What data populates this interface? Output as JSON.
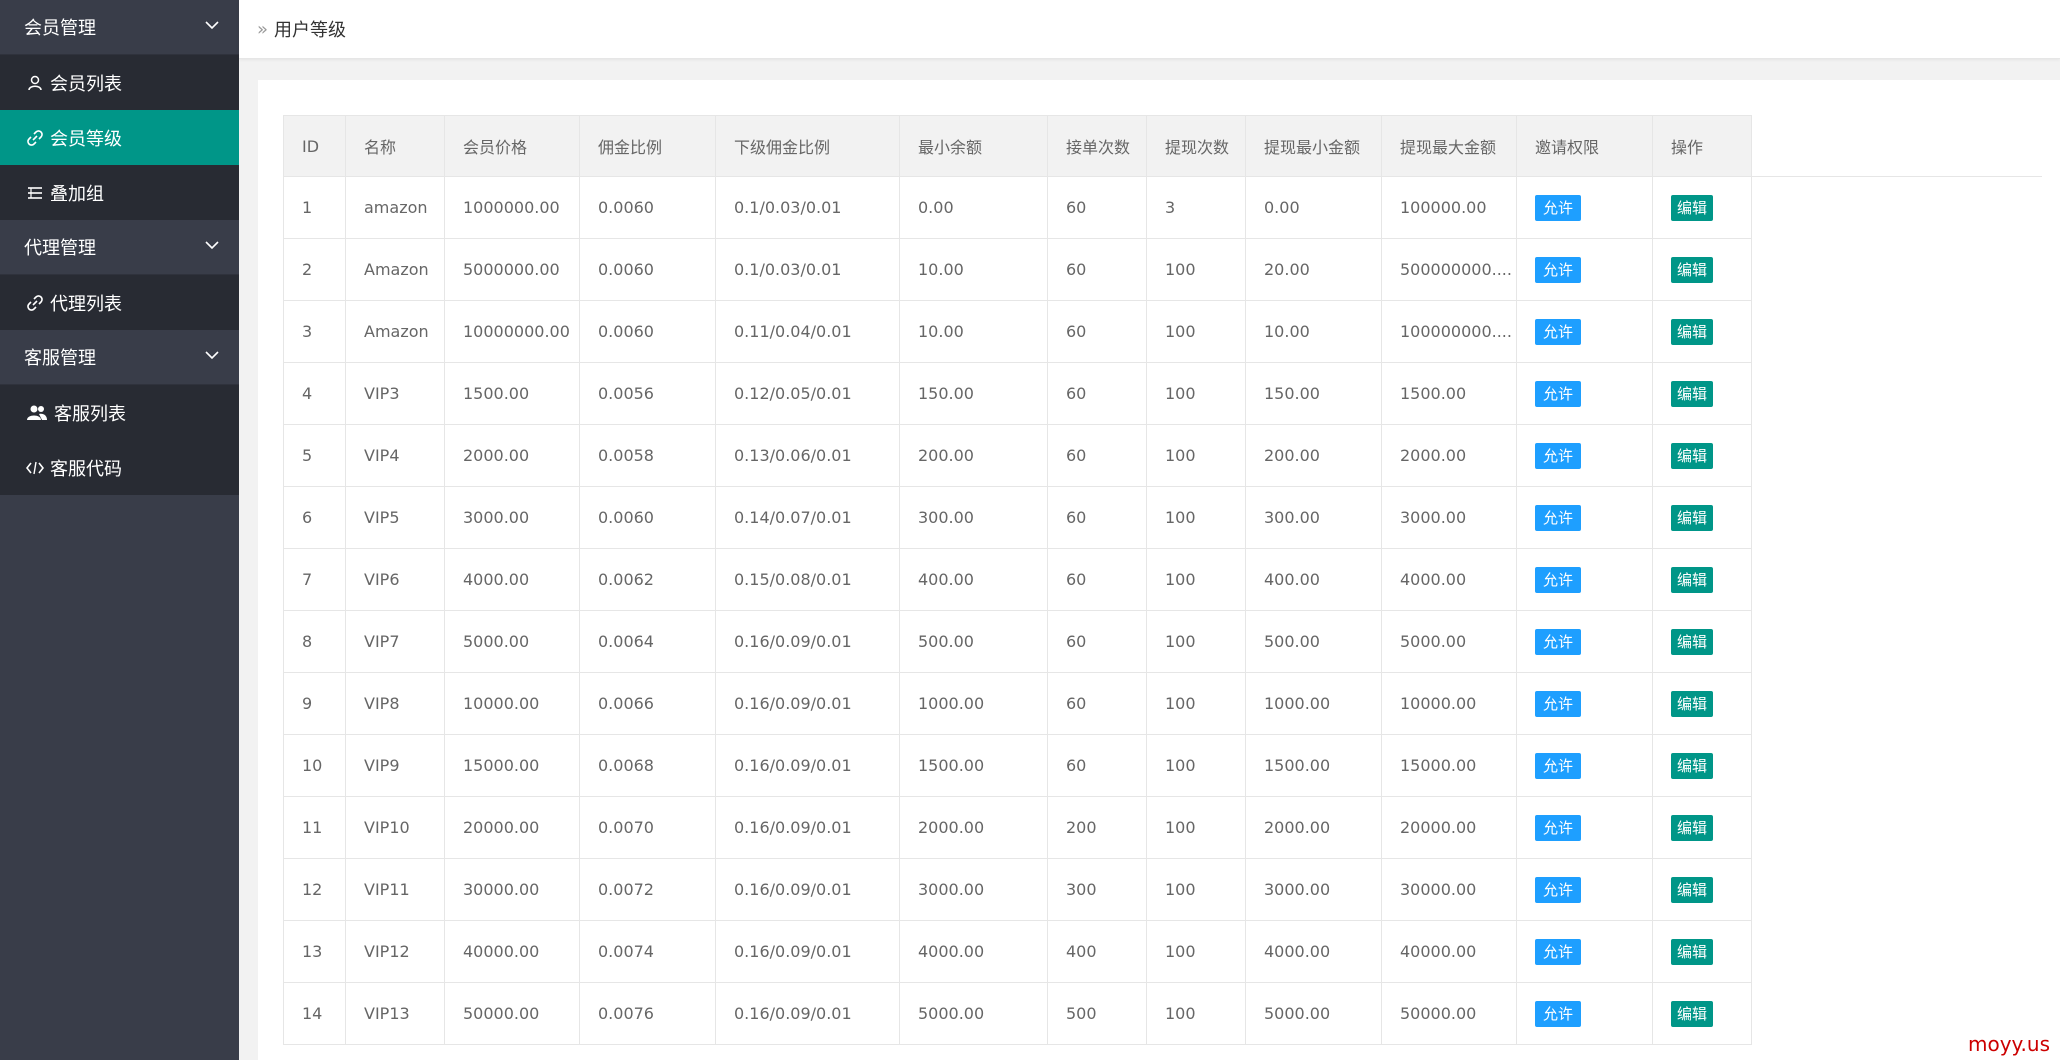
{
  "sidebar": {
    "groups": [
      {
        "label": "会员管理",
        "items": [
          {
            "label": "会员列表",
            "icon": "user-icon",
            "active": false
          },
          {
            "label": "会员等级",
            "icon": "link-icon",
            "active": true
          },
          {
            "label": "叠加组",
            "icon": "list-icon",
            "active": false
          }
        ]
      },
      {
        "label": "代理管理",
        "items": [
          {
            "label": "代理列表",
            "icon": "link-icon",
            "active": false
          }
        ]
      },
      {
        "label": "客服管理",
        "items": [
          {
            "label": "客服列表",
            "icon": "users-icon",
            "active": false
          },
          {
            "label": "客服代码",
            "icon": "code-icon",
            "active": false
          }
        ]
      }
    ]
  },
  "header": {
    "breadcrumb_sep": "»",
    "title": "用户等级"
  },
  "table": {
    "columns": [
      "ID",
      "名称",
      "会员价格",
      "佣金比例",
      "下级佣金比例",
      "最小余额",
      "接单次数",
      "提现次数",
      "提现最小金额",
      "提现最大金额",
      "邀请权限",
      "操作"
    ],
    "rows": [
      {
        "id": "1",
        "name": "amazon",
        "price": "1000000.00",
        "rate": "0.0060",
        "sub_rate": "0.1/0.03/0.01",
        "min_balance": "0.00",
        "orders": "60",
        "withdraws": "3",
        "wd_min": "0.00",
        "wd_max": "100000.00",
        "invite": "允许",
        "action": "编辑"
      },
      {
        "id": "2",
        "name": "Amazon",
        "price": "5000000.00",
        "rate": "0.0060",
        "sub_rate": "0.1/0.03/0.01",
        "min_balance": "10.00",
        "orders": "60",
        "withdraws": "100",
        "wd_min": "20.00",
        "wd_max": "500000000....",
        "invite": "允许",
        "action": "编辑"
      },
      {
        "id": "3",
        "name": "Amazon",
        "price": "10000000.00",
        "rate": "0.0060",
        "sub_rate": "0.11/0.04/0.01",
        "min_balance": "10.00",
        "orders": "60",
        "withdraws": "100",
        "wd_min": "10.00",
        "wd_max": "100000000....",
        "invite": "允许",
        "action": "编辑"
      },
      {
        "id": "4",
        "name": "VIP3",
        "price": "1500.00",
        "rate": "0.0056",
        "sub_rate": "0.12/0.05/0.01",
        "min_balance": "150.00",
        "orders": "60",
        "withdraws": "100",
        "wd_min": "150.00",
        "wd_max": "1500.00",
        "invite": "允许",
        "action": "编辑"
      },
      {
        "id": "5",
        "name": "VIP4",
        "price": "2000.00",
        "rate": "0.0058",
        "sub_rate": "0.13/0.06/0.01",
        "min_balance": "200.00",
        "orders": "60",
        "withdraws": "100",
        "wd_min": "200.00",
        "wd_max": "2000.00",
        "invite": "允许",
        "action": "编辑"
      },
      {
        "id": "6",
        "name": "VIP5",
        "price": "3000.00",
        "rate": "0.0060",
        "sub_rate": "0.14/0.07/0.01",
        "min_balance": "300.00",
        "orders": "60",
        "withdraws": "100",
        "wd_min": "300.00",
        "wd_max": "3000.00",
        "invite": "允许",
        "action": "编辑"
      },
      {
        "id": "7",
        "name": "VIP6",
        "price": "4000.00",
        "rate": "0.0062",
        "sub_rate": "0.15/0.08/0.01",
        "min_balance": "400.00",
        "orders": "60",
        "withdraws": "100",
        "wd_min": "400.00",
        "wd_max": "4000.00",
        "invite": "允许",
        "action": "编辑"
      },
      {
        "id": "8",
        "name": "VIP7",
        "price": "5000.00",
        "rate": "0.0064",
        "sub_rate": "0.16/0.09/0.01",
        "min_balance": "500.00",
        "orders": "60",
        "withdraws": "100",
        "wd_min": "500.00",
        "wd_max": "5000.00",
        "invite": "允许",
        "action": "编辑"
      },
      {
        "id": "9",
        "name": "VIP8",
        "price": "10000.00",
        "rate": "0.0066",
        "sub_rate": "0.16/0.09/0.01",
        "min_balance": "1000.00",
        "orders": "60",
        "withdraws": "100",
        "wd_min": "1000.00",
        "wd_max": "10000.00",
        "invite": "允许",
        "action": "编辑"
      },
      {
        "id": "10",
        "name": "VIP9",
        "price": "15000.00",
        "rate": "0.0068",
        "sub_rate": "0.16/0.09/0.01",
        "min_balance": "1500.00",
        "orders": "60",
        "withdraws": "100",
        "wd_min": "1500.00",
        "wd_max": "15000.00",
        "invite": "允许",
        "action": "编辑"
      },
      {
        "id": "11",
        "name": "VIP10",
        "price": "20000.00",
        "rate": "0.0070",
        "sub_rate": "0.16/0.09/0.01",
        "min_balance": "2000.00",
        "orders": "200",
        "withdraws": "100",
        "wd_min": "2000.00",
        "wd_max": "20000.00",
        "invite": "允许",
        "action": "编辑"
      },
      {
        "id": "12",
        "name": "VIP11",
        "price": "30000.00",
        "rate": "0.0072",
        "sub_rate": "0.16/0.09/0.01",
        "min_balance": "3000.00",
        "orders": "300",
        "withdraws": "100",
        "wd_min": "3000.00",
        "wd_max": "30000.00",
        "invite": "允许",
        "action": "编辑"
      },
      {
        "id": "13",
        "name": "VIP12",
        "price": "40000.00",
        "rate": "0.0074",
        "sub_rate": "0.16/0.09/0.01",
        "min_balance": "4000.00",
        "orders": "400",
        "withdraws": "100",
        "wd_min": "4000.00",
        "wd_max": "40000.00",
        "invite": "允许",
        "action": "编辑"
      },
      {
        "id": "14",
        "name": "VIP13",
        "price": "50000.00",
        "rate": "0.0076",
        "sub_rate": "0.16/0.09/0.01",
        "min_balance": "5000.00",
        "orders": "500",
        "withdraws": "100",
        "wd_min": "5000.00",
        "wd_max": "50000.00",
        "invite": "允许",
        "action": "编辑"
      }
    ]
  },
  "watermark": "moyy.us",
  "colors": {
    "sidebar_bg": "#393d49",
    "active": "#009688",
    "badge_blue": "#1e9fff"
  }
}
